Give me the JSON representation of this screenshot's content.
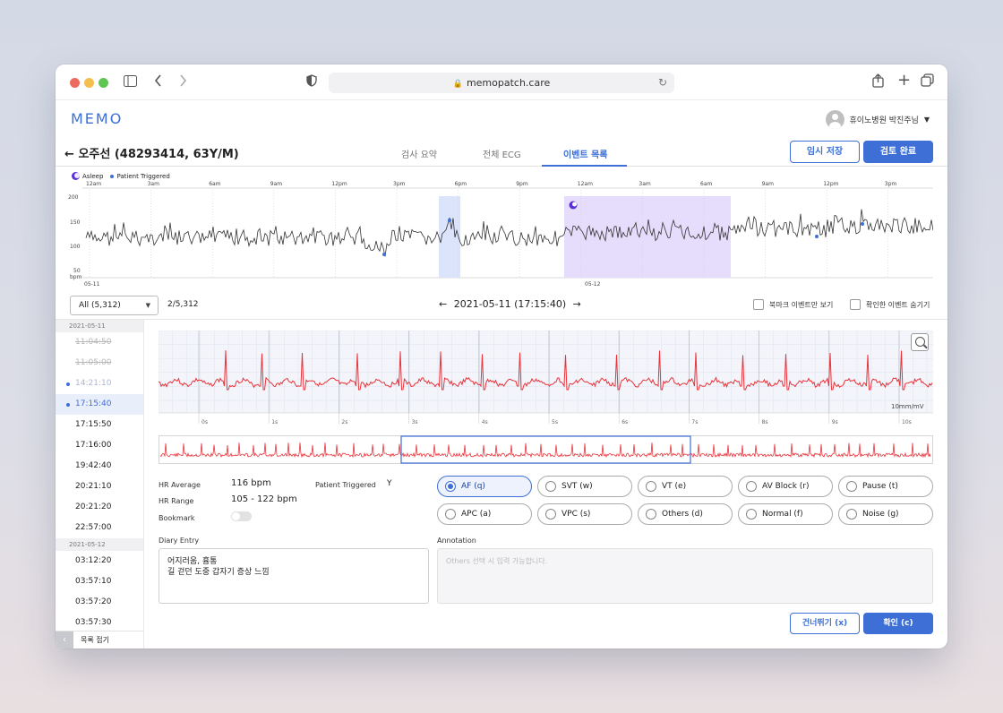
{
  "browser": {
    "url": "memopatch.care"
  },
  "app": {
    "logo": "MEMO",
    "user_name": "휴이노병원 박진주님"
  },
  "patient": {
    "title": "오주선 (48293414, 63Y/M)",
    "tabs": [
      "검사 요약",
      "전체 ECG",
      "이벤트 목록"
    ],
    "active_tab": 2,
    "save_temp_label": "임시 저장",
    "review_done_label": "검토 완료"
  },
  "trend": {
    "legend_asleep": "Asleep",
    "legend_patient_triggered": "Patient Triggered",
    "time_labels": [
      "12am",
      "3am",
      "6am",
      "9am",
      "12pm",
      "3pm",
      "6pm",
      "9pm",
      "12am",
      "3am",
      "6am",
      "9am",
      "12pm",
      "3pm"
    ],
    "y_labels": [
      "200",
      "150",
      "100",
      "50"
    ],
    "y_unit": "bpm",
    "date_labels": [
      "05-11",
      "05-12"
    ],
    "colors": {
      "asleep": "#5b2fd8",
      "asleep_band": "#e6dcfb",
      "highlight_band": "#dbe4fb",
      "line": "#333333",
      "marker": "#3d6fd6"
    }
  },
  "filter": {
    "selected": "All (5,312)",
    "count": "2/5,312",
    "date_time": "2021-05-11 (17:15:40)",
    "prev_arrow": "←",
    "next_arrow": "→",
    "bookmark_only_label": "북마크 이벤트만 보기",
    "hide_confirmed_label": "확인한 이벤트 숨기기"
  },
  "event_list": {
    "groups": [
      {
        "date": "2021-05-11",
        "items": [
          {
            "time": "11:04:50",
            "state": "strike"
          },
          {
            "time": "11:05:00",
            "state": "strike"
          },
          {
            "time": "14:21:10",
            "state": "viewed"
          },
          {
            "time": "17:15:40",
            "state": "active"
          },
          {
            "time": "17:15:50",
            "state": ""
          },
          {
            "time": "17:16:00",
            "state": ""
          },
          {
            "time": "19:42:40",
            "state": ""
          },
          {
            "time": "20:21:10",
            "state": ""
          },
          {
            "time": "20:21:20",
            "state": ""
          },
          {
            "time": "22:57:00",
            "state": ""
          }
        ]
      },
      {
        "date": "2021-05-12",
        "items": [
          {
            "time": "03:12:20",
            "state": ""
          },
          {
            "time": "03:57:10",
            "state": ""
          },
          {
            "time": "03:57:20",
            "state": ""
          },
          {
            "time": "03:57:30",
            "state": ""
          }
        ]
      }
    ],
    "collapse_label": "목록 접기"
  },
  "ecg": {
    "time_ticks": [
      "0s",
      "1s",
      "2s",
      "3s",
      "4s",
      "5s",
      "6s",
      "7s",
      "8s",
      "9s",
      "10s"
    ],
    "scale": "10mm/mV",
    "color": "#e8333a"
  },
  "details": {
    "hr_average_label": "HR Average",
    "hr_average_value": "116 bpm",
    "hr_range_label": "HR Range",
    "hr_range_value": "105 - 122 bpm",
    "bookmark_label": "Bookmark",
    "bookmark_on": false,
    "patient_triggered_label": "Patient Triggered",
    "patient_triggered_value": "Y",
    "diary_label": "Diary Entry",
    "diary_text": "어지러움, 흉통\n길 걷던 도중 갑자기 증상 느낌",
    "annotation_label": "Annotation",
    "annotation_placeholder": "Others 선택 시 입력 가능합니다."
  },
  "classification": {
    "options": [
      "AF (q)",
      "SVT (w)",
      "VT (e)",
      "AV Block (r)",
      "Pause (t)",
      "APC (a)",
      "VPC (s)",
      "Others (d)",
      "Normal (f)",
      "Noise (g)"
    ],
    "selected": "AF (q)"
  },
  "actions": {
    "skip_label": "건너뛰기 (x)",
    "confirm_label": "확인 (c)"
  }
}
